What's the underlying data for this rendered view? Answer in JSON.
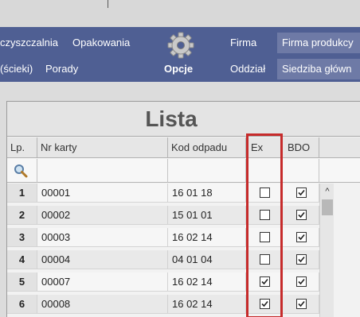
{
  "nav": {
    "left_top_1": "czyszczalnia",
    "left_top_2": "Opakowania",
    "left_bottom_1": "(ścieki)",
    "left_bottom_2": "Porady",
    "center_label": "Opcje",
    "firma_label": "Firma",
    "firma_value": "Firma produkcy",
    "oddzial_label": "Oddział",
    "oddzial_value": "Siedziba główn"
  },
  "list": {
    "title": "Lista",
    "columns": {
      "lp": "Lp.",
      "nr": "Nr karty",
      "kod": "Kod odpadu",
      "ex": "Ex",
      "bdo": "BDO"
    },
    "rows": [
      {
        "lp": "1",
        "nr": "00001",
        "kod": "16 01 18",
        "ex": false,
        "bdo": true
      },
      {
        "lp": "2",
        "nr": "00002",
        "kod": "15 01 01",
        "ex": false,
        "bdo": true
      },
      {
        "lp": "3",
        "nr": "00003",
        "kod": "16 02 14",
        "ex": false,
        "bdo": true
      },
      {
        "lp": "4",
        "nr": "00004",
        "kod": "04 01 04",
        "ex": false,
        "bdo": true
      },
      {
        "lp": "5",
        "nr": "00007",
        "kod": "16 02 14",
        "ex": true,
        "bdo": true
      },
      {
        "lp": "6",
        "nr": "00008",
        "kod": "16 02 14",
        "ex": true,
        "bdo": true
      }
    ]
  },
  "icons": {
    "gear": "gear-icon",
    "search": "search-icon",
    "scroll_up": "chevron-up-icon"
  },
  "colors": {
    "navbar": "#4f5f93",
    "highlight": "#c62b2b"
  }
}
